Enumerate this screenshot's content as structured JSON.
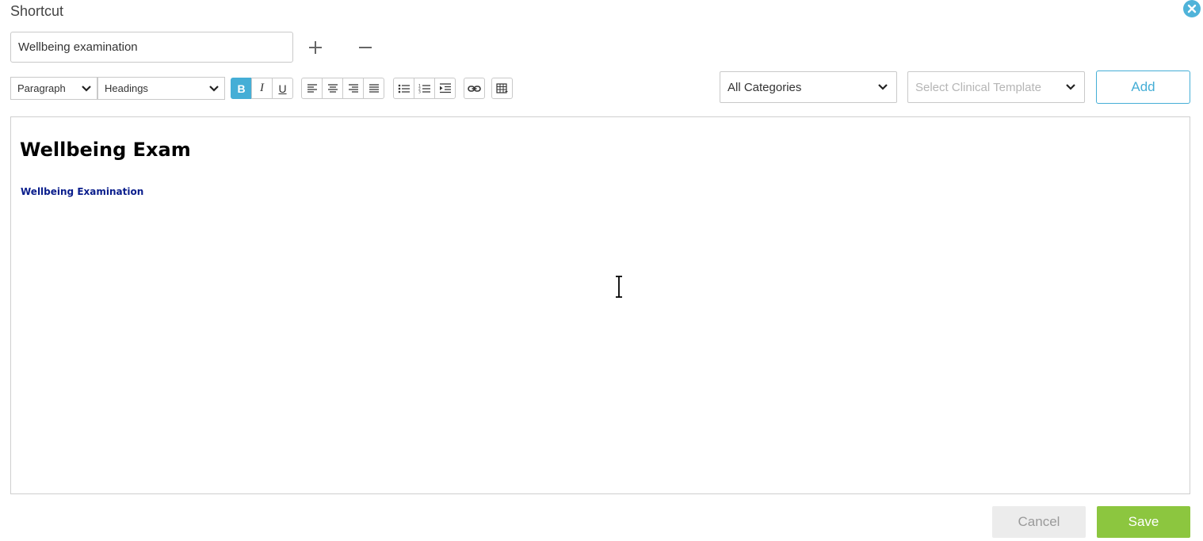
{
  "dialog": {
    "title": "Shortcut"
  },
  "shortcut": {
    "name_value": "Wellbeing examination"
  },
  "toolbar": {
    "paragraph_select": "Paragraph",
    "headings_select": "Headings",
    "bold_label": "B",
    "italic_label": "I",
    "underline_label": "U"
  },
  "filters": {
    "category_select": "All Categories",
    "template_placeholder": "Select Clinical Template",
    "add_label": "Add"
  },
  "editor": {
    "heading": "Wellbeing Exam",
    "subheading": "Wellbeing Examination"
  },
  "footer": {
    "cancel_label": "Cancel",
    "save_label": "Save"
  },
  "colors": {
    "accent": "#45aed6",
    "save": "#8cc63f",
    "subheading_text": "#0a1e8c"
  }
}
